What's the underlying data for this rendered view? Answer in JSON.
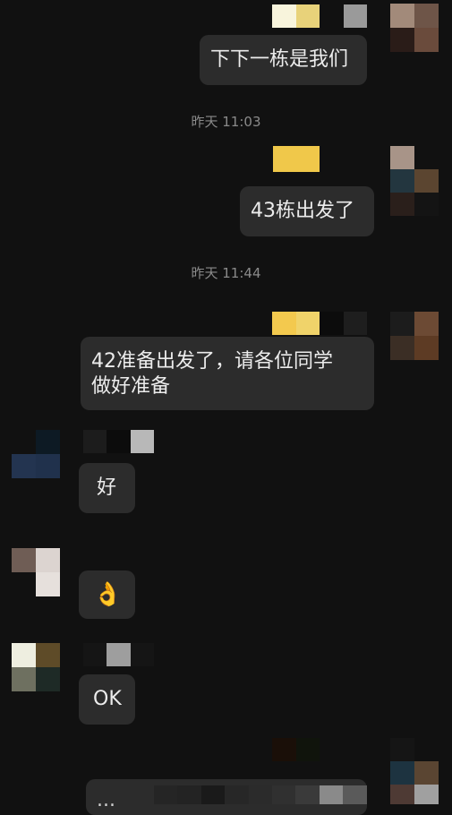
{
  "messages": [
    {
      "side": "right",
      "text": "下下一栋是我们"
    },
    {
      "type": "time",
      "text": "昨天 11:03"
    },
    {
      "side": "right",
      "text": "43栋出发了"
    },
    {
      "type": "time",
      "text": "昨天 11:44"
    },
    {
      "side": "right",
      "text_line1": "42准备出发了，请各位同学",
      "text_line2": "做好准备"
    },
    {
      "side": "left",
      "text": "好"
    },
    {
      "side": "left",
      "text": "👌"
    },
    {
      "side": "left",
      "text": "OK"
    },
    {
      "side": "right",
      "text": "..."
    }
  ],
  "colors": {
    "background": "#111111",
    "bubble": "#2c2c2c",
    "timestamp": "#8a8a8a"
  }
}
